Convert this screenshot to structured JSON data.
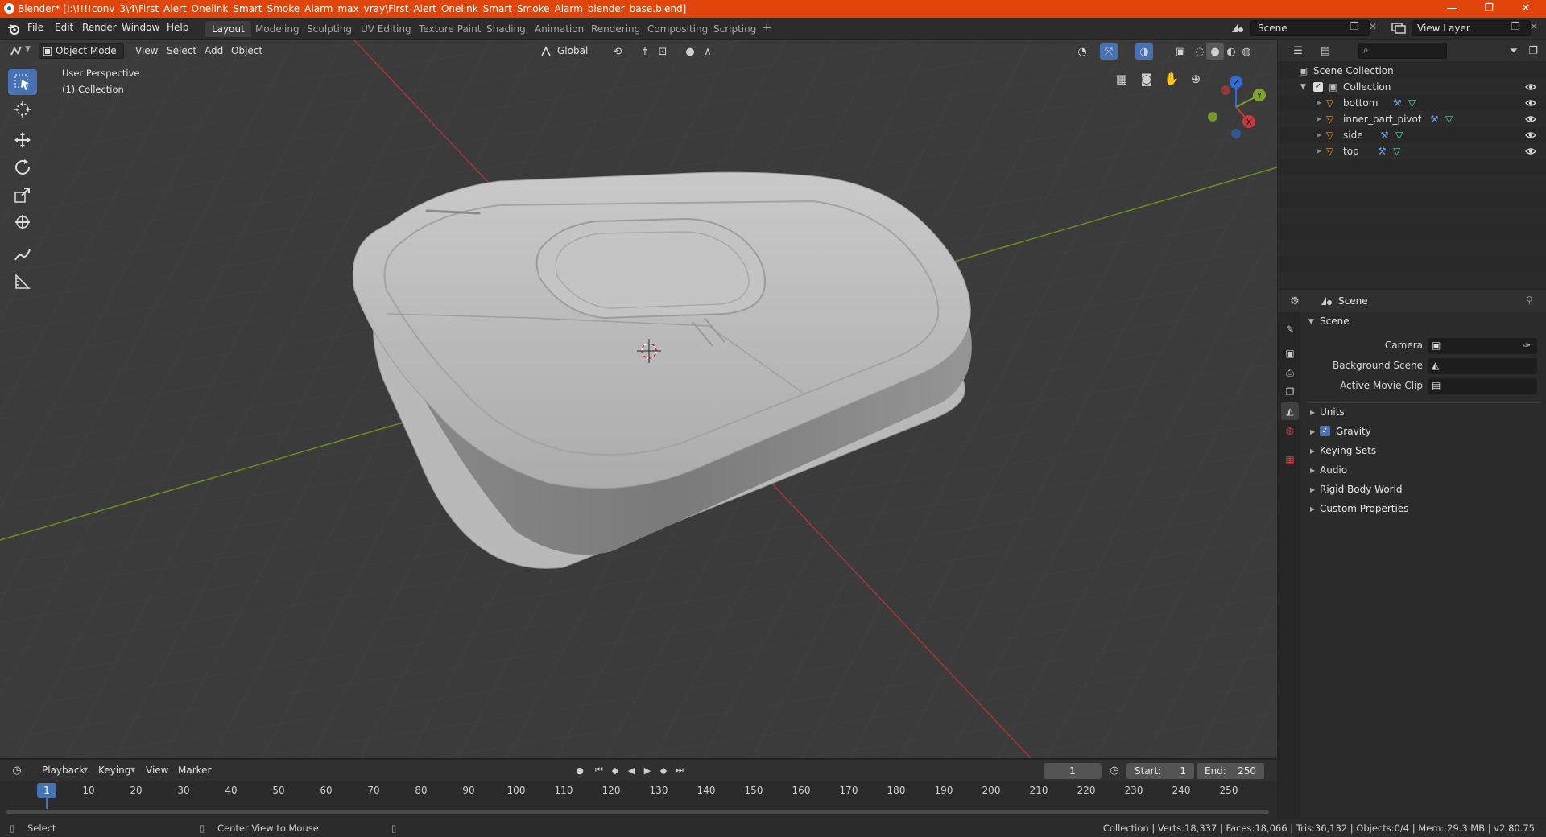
{
  "title_bar": {
    "title": "Blender* [I:\\!!!!conv_3\\4\\First_Alert_Onelink_Smart_Smoke_Alarm_max_vray\\First_Alert_Onelink_Smart_Smoke_Alarm_blender_base.blend]",
    "minimize": "—",
    "maximize": "❐",
    "close": "✕"
  },
  "menu": [
    "File",
    "Edit",
    "Render",
    "Window",
    "Help"
  ],
  "workspaces": [
    "Layout",
    "Modeling",
    "Sculpting",
    "UV Editing",
    "Texture Paint",
    "Shading",
    "Animation",
    "Rendering",
    "Compositing",
    "Scripting"
  ],
  "active_workspace": "Layout",
  "scene_field": "Scene",
  "view_layer_field": "View Layer",
  "viewport": {
    "mode": "Object Mode",
    "menus": [
      "View",
      "Select",
      "Add",
      "Object"
    ],
    "orientation": "Global",
    "perspective_label": "User Perspective",
    "collection_label": "(1) Collection",
    "gizmo": {
      "x": "X",
      "y": "Y",
      "z": "Z"
    }
  },
  "outliner": {
    "root": "Scene Collection",
    "collection": "Collection",
    "objects": [
      "bottom",
      "inner_part_pivot",
      "side",
      "top"
    ]
  },
  "properties": {
    "header": "Scene",
    "panel": "Scene",
    "camera_label": "Camera",
    "background_scene_label": "Background Scene",
    "active_movie_clip_label": "Active Movie Clip",
    "sections": [
      "Units",
      "Gravity",
      "Keying Sets",
      "Audio",
      "Rigid Body World",
      "Custom Properties"
    ]
  },
  "timeline": {
    "menus": [
      "Playback",
      "Keying",
      "View",
      "Marker"
    ],
    "current_frame": "1",
    "start_label": "Start:",
    "start": "1",
    "end_label": "End:",
    "end": "250",
    "ticks": [
      "1",
      "10",
      "20",
      "30",
      "40",
      "50",
      "60",
      "70",
      "80",
      "90",
      "100",
      "110",
      "120",
      "130",
      "140",
      "150",
      "160",
      "170",
      "180",
      "190",
      "200",
      "210",
      "220",
      "230",
      "240",
      "250"
    ]
  },
  "status_bar": {
    "left": "Select",
    "middle": "Center View to Mouse",
    "right": "Collection | Verts:18,337 | Faces:18,066 | Tris:36,132 | Objects:0/4 | Mem: 29.3 MB | v2.80.75"
  },
  "colors": {
    "title_bar": "#e0450c",
    "accent": "#4772b3",
    "x_axis": "#c8393e",
    "y_axis": "#7ea22a",
    "z_axis": "#2f6bd0"
  }
}
